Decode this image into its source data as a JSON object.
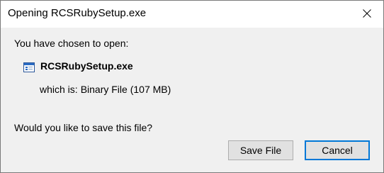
{
  "dialog": {
    "title": "Opening RCSRubySetup.exe",
    "close_icon": "close-icon",
    "prompt": "You have chosen to open:",
    "file": {
      "icon": "executable-file-icon",
      "name": "RCSRubySetup.exe",
      "type_label": "which is:",
      "type_value": "Binary File (107 MB)"
    },
    "question": "Would you like to save this file?",
    "buttons": {
      "save": "Save File",
      "cancel": "Cancel"
    },
    "colors": {
      "focus_border": "#0078d7",
      "client_background": "#f0f0f0",
      "button_background": "#e1e1e1"
    }
  }
}
